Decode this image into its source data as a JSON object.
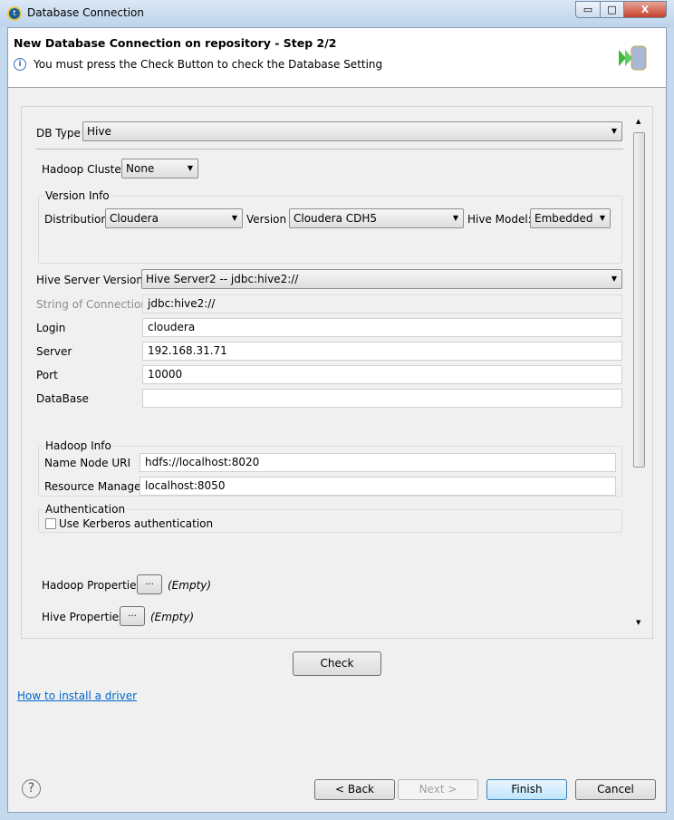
{
  "window": {
    "title": "Database Connection",
    "minimize": "▭",
    "maximize": "□",
    "close": "X"
  },
  "header": {
    "title": "New Database Connection on repository - Step 2/2",
    "message": "You must press the Check Button to check the Database Setting"
  },
  "form": {
    "db_type_label": "DB Type",
    "db_type": "Hive",
    "hadoop_cluster_label": "Hadoop Cluster",
    "hadoop_cluster": "None",
    "version_info_title": "Version Info",
    "distribution_label": "Distribution",
    "distribution": "Cloudera",
    "version_label": "Version",
    "version": "Cloudera CDH5",
    "hive_model_label": "Hive Model:",
    "hive_model": "Embedded",
    "hive_server_version_label": "Hive Server Version",
    "hive_server_version": "Hive Server2 -- jdbc:hive2://",
    "connection_string_label": "String of Connection",
    "connection_string": "jdbc:hive2://",
    "login_label": "Login",
    "login": "cloudera",
    "server_label": "Server",
    "server": "192.168.31.71",
    "port_label": "Port",
    "port": "10000",
    "database_label": "DataBase",
    "database": "",
    "hadoop_info_title": "Hadoop Info",
    "name_node_label": "Name Node URI",
    "name_node": "hdfs://localhost:8020",
    "resource_manager_label": "Resource Manager",
    "resource_manager": "localhost:8050",
    "auth_title": "Authentication",
    "kerberos_label": "Use Kerberos authentication",
    "kerberos_checked": false,
    "hadoop_props_label": "Hadoop Properties",
    "hadoop_props_value": "(Empty)",
    "hive_props_label": "Hive Properties",
    "hive_props_value": "(Empty)",
    "ellipsis": "..."
  },
  "check_button": "Check",
  "driver_link": "How to install a driver",
  "footer": {
    "help": "?",
    "back": "< Back",
    "next": "Next >",
    "finish": "Finish",
    "cancel": "Cancel"
  }
}
